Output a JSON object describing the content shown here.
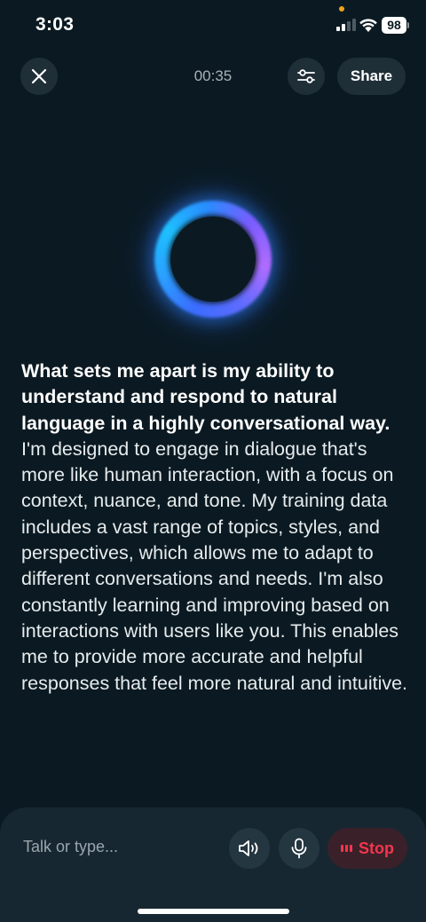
{
  "status_bar": {
    "time": "3:03",
    "battery": "98",
    "mic_indicator_color": "#f2a31b"
  },
  "header": {
    "timer": "00:35",
    "share_label": "Share",
    "close_icon": "close-icon",
    "settings_icon": "sliders-icon"
  },
  "orb": {
    "colors": [
      "#2aa0ff",
      "#1ec0ff",
      "#7a5cff",
      "#b06cff"
    ]
  },
  "transcript": {
    "highlight": "What sets me apart is my ability to understand and respond to natural language in a highly conversational way.",
    "body": " I'm designed to engage in dialogue that's more like human interaction, with a focus on context, nuance, and tone. My training data includes a vast range of topics, styles, and perspectives, which allows me to adapt to different conversations and needs. I'm also constantly learning and improving based on interactions with users like you. This enables me to provide more accurate and helpful responses that feel more natural and intuitive."
  },
  "input_bar": {
    "placeholder": "Talk or type...",
    "speaker_icon": "speaker-icon",
    "mic_icon": "microphone-icon",
    "stop_label": "Stop",
    "stop_color": "#f3354d"
  },
  "colors": {
    "background": "#0b1a22",
    "panel": "#172731",
    "button": "#1f2f38"
  }
}
